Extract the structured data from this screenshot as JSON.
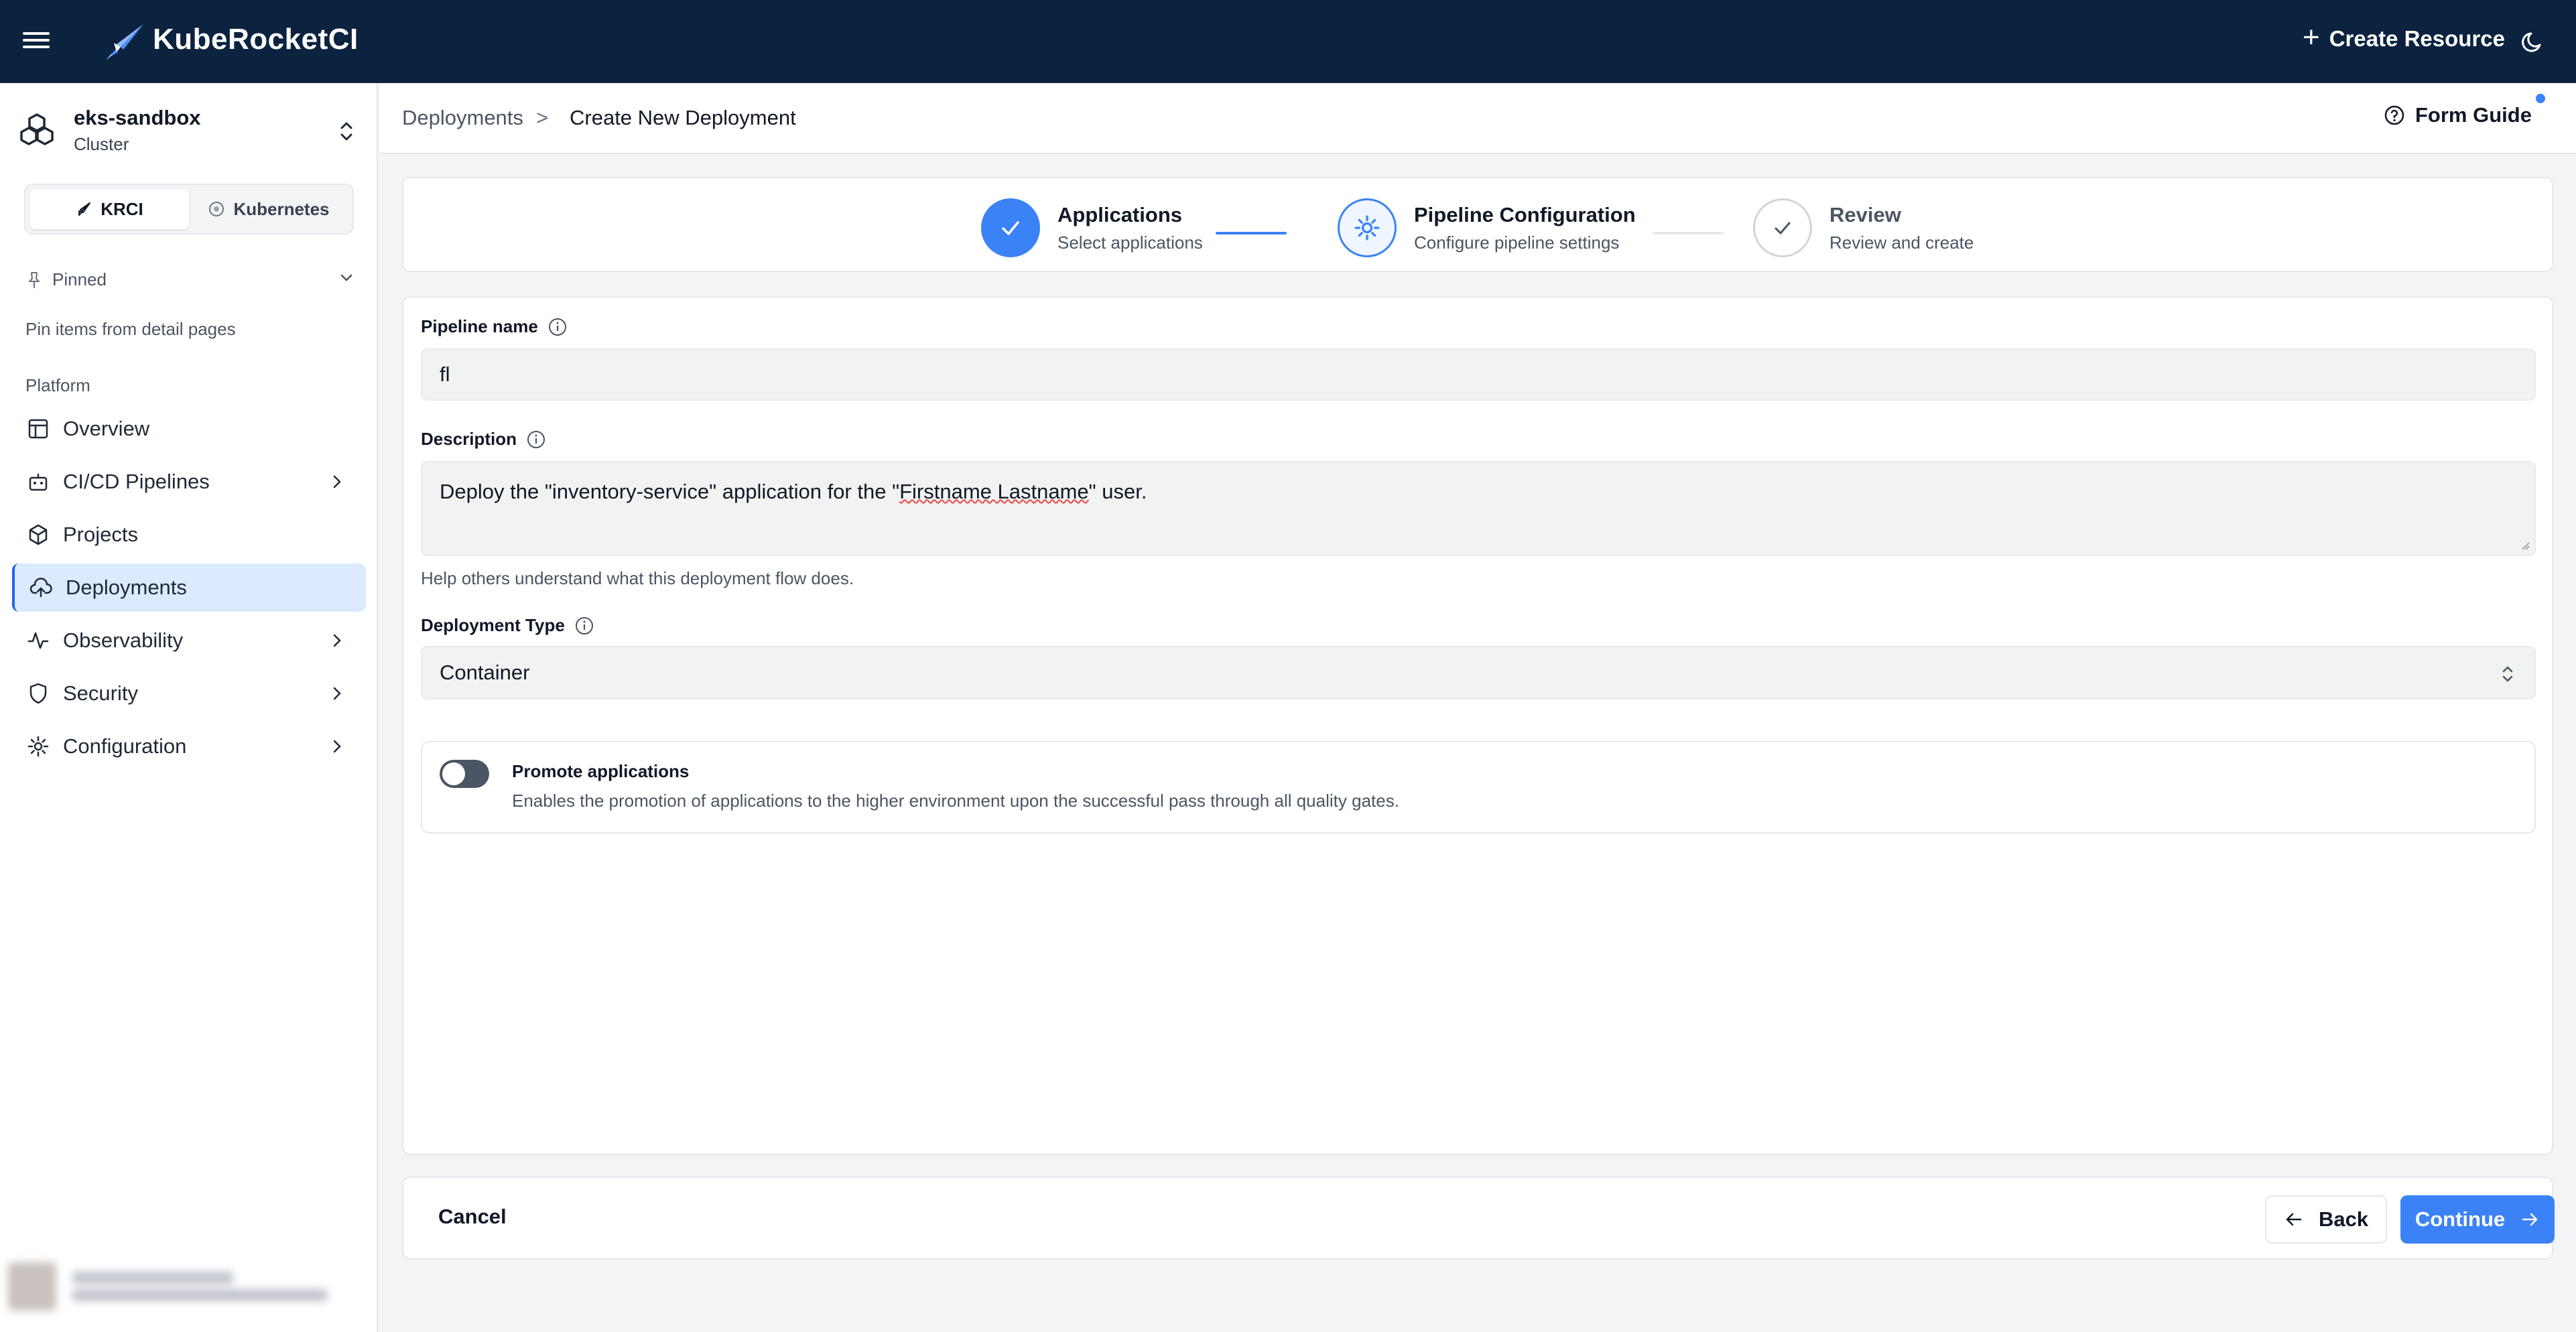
{
  "app": {
    "name": "KubeRocketCI"
  },
  "topbar": {
    "create_resource_label": "Create Resource"
  },
  "sidebar": {
    "cluster_name": "eks-sandbox",
    "cluster_type": "Cluster",
    "mode_tabs": [
      {
        "label": "KRCI",
        "active": true
      },
      {
        "label": "Kubernetes",
        "active": false
      }
    ],
    "pinned_label": "Pinned",
    "pinned_hint": "Pin items from detail pages",
    "section_label": "Platform",
    "items": [
      {
        "label": "Overview",
        "icon": "layout-icon",
        "has_arrow": false,
        "active": false
      },
      {
        "label": "CI/CD Pipelines",
        "icon": "robot-icon",
        "has_arrow": true,
        "active": false
      },
      {
        "label": "Projects",
        "icon": "box-icon",
        "has_arrow": false,
        "active": false
      },
      {
        "label": "Deployments",
        "icon": "cloud-upload-icon",
        "has_arrow": false,
        "active": true
      },
      {
        "label": "Observability",
        "icon": "activity-icon",
        "has_arrow": true,
        "active": false
      },
      {
        "label": "Security",
        "icon": "shield-icon",
        "has_arrow": true,
        "active": false
      },
      {
        "label": "Configuration",
        "icon": "gear-icon",
        "has_arrow": true,
        "active": false
      }
    ]
  },
  "breadcrumb": {
    "parent": "Deployments",
    "separator": ">",
    "current": "Create New Deployment"
  },
  "form_guide_label": "Form Guide",
  "stepper": [
    {
      "title": "Applications",
      "subtitle": "Select applications",
      "state": "done"
    },
    {
      "title": "Pipeline Configuration",
      "subtitle": "Configure pipeline settings",
      "state": "current"
    },
    {
      "title": "Review",
      "subtitle": "Review and create",
      "state": "pending"
    }
  ],
  "form": {
    "pipeline_name_label": "Pipeline name",
    "pipeline_name_value": "fl",
    "description_label": "Description",
    "description_value_pre": "Deploy the \"inventory-service\" application for the \"",
    "description_value_flag": "Firstname Lastname",
    "description_value_post": "\" user.",
    "description_helper": "Help others understand what this deployment flow does.",
    "deployment_type_label": "Deployment Type",
    "deployment_type_value": "Container",
    "promote_title": "Promote applications",
    "promote_desc": "Enables the promotion of applications to the higher environment upon the successful pass through all quality gates.",
    "promote_enabled": false
  },
  "footer": {
    "cancel_label": "Cancel",
    "back_label": "Back",
    "continue_label": "Continue"
  },
  "colors": {
    "topbar": "#0c2340",
    "accent": "#3b82f6",
    "active_nav_bg": "#dbeafe"
  }
}
